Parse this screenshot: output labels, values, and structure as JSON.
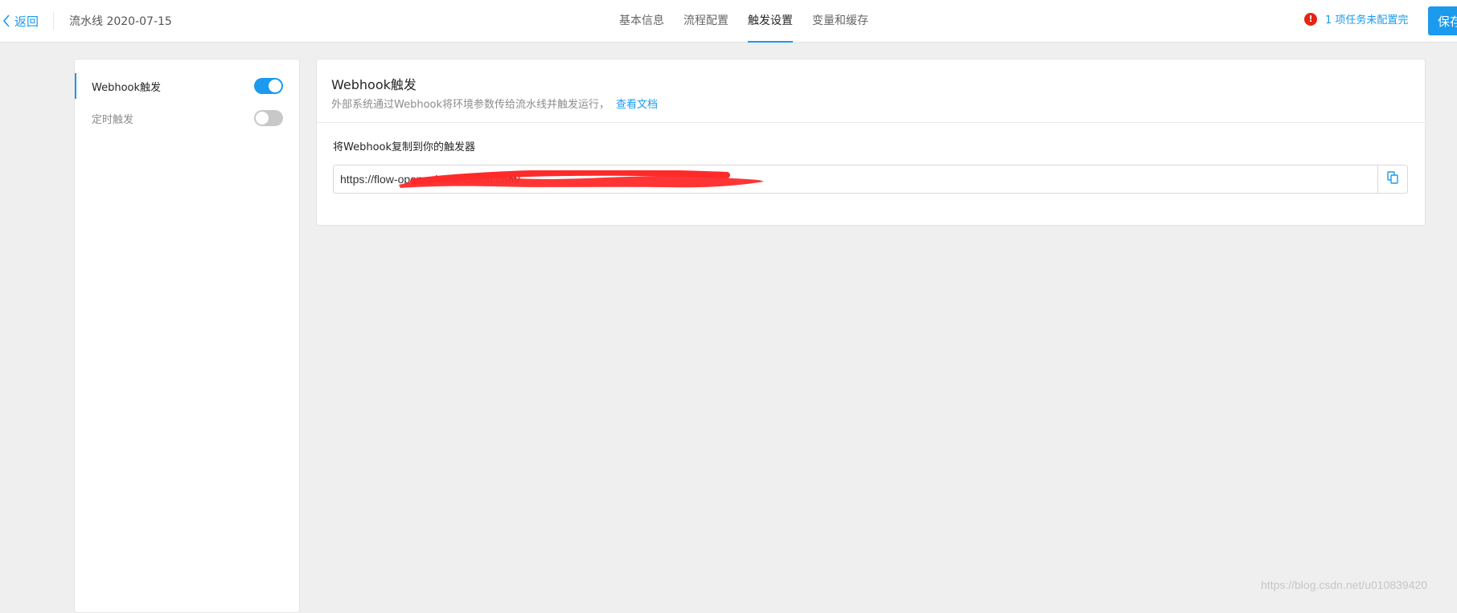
{
  "header": {
    "back_label": "返回",
    "pipeline_name": "流水线 2020-07-15",
    "tabs": [
      {
        "label": "基本信息",
        "active": false
      },
      {
        "label": "流程配置",
        "active": false
      },
      {
        "label": "触发设置",
        "active": true
      },
      {
        "label": "变量和缓存",
        "active": false
      }
    ],
    "warning_badge": "!",
    "warning_text": "1 项任务未配置完",
    "save_label": "保存"
  },
  "sidebar": {
    "items": [
      {
        "label": "Webhook触发",
        "enabled": true,
        "active": true
      },
      {
        "label": "定时触发",
        "enabled": false,
        "active": false
      }
    ]
  },
  "card": {
    "title": "Webhook触发",
    "description": "外部系统通过Webhook将环境参数传给流水线并触发运行，",
    "doc_link": "查看文档",
    "field_label": "将Webhook复制到你的触发器",
    "webhook_url": "https://flow-openapi.teambition.com/"
  },
  "watermark": "https://blog.csdn.net/u010839420",
  "colors": {
    "accent": "#1b9aee",
    "warning": "#e62412",
    "redaction": "#ff2a2a",
    "background": "#efefef"
  }
}
